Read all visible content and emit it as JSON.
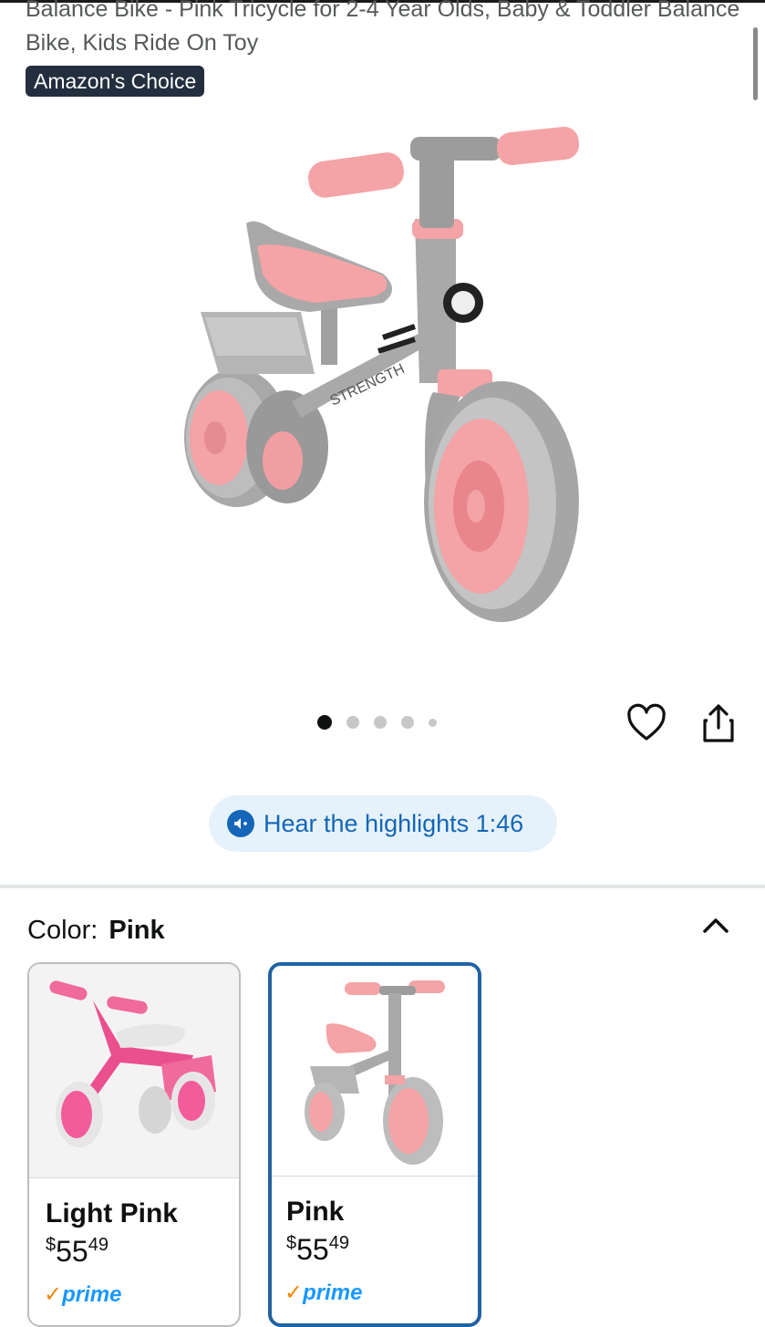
{
  "product": {
    "title": "Balance Bike - Pink Tricycle for 2-4 Year Olds, Baby & Toddler Balance Bike, Kids Ride On Toy",
    "badge": "Amazon's Choice"
  },
  "gallery": {
    "image_count": 5,
    "active_index": 0
  },
  "actions": {
    "favorite_icon": "heart-icon",
    "share_icon": "share-icon"
  },
  "audio": {
    "label": "Hear the highlights 1:46",
    "icon": "speaker-icon"
  },
  "color_selector": {
    "label": "Color:",
    "selected": "Pink",
    "options": [
      {
        "name": "Light Pink",
        "currency": "$",
        "dollars": "55",
        "cents": "49",
        "prime_check": "✓",
        "prime": "prime"
      },
      {
        "name": "Pink",
        "currency": "$",
        "dollars": "55",
        "cents": "49",
        "prime_check": "✓",
        "prime": "prime"
      }
    ]
  },
  "colors": {
    "accent_blue": "#1566b8",
    "selected_border": "#2162a1",
    "badge_bg": "#232f3e",
    "bike_pink": "#f4a3a6",
    "bike_gray": "#a9a9a9"
  }
}
